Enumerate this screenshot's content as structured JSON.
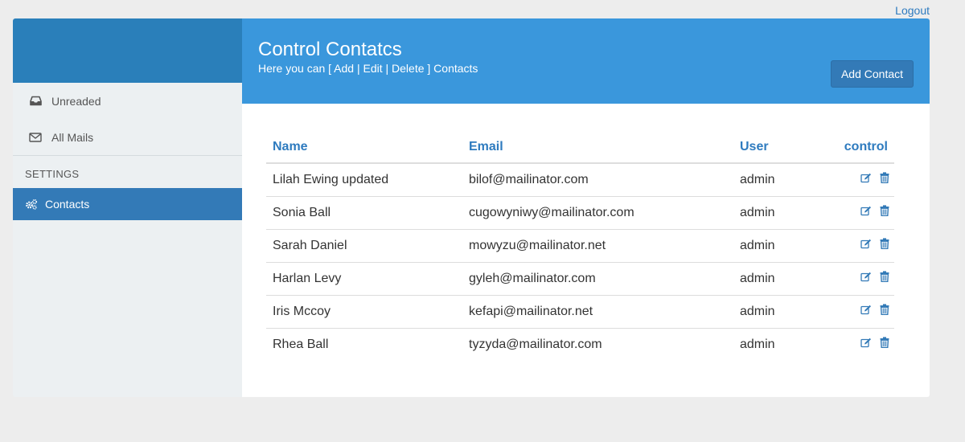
{
  "topbar": {
    "logout_label": "Logout"
  },
  "sidebar": {
    "items": [
      {
        "label": "Unreaded",
        "icon": "inbox-icon"
      },
      {
        "label": "All Mails",
        "icon": "envelope-icon"
      }
    ],
    "section_label": "SETTINGS",
    "active_item": {
      "label": "Contacts",
      "icon": "gears-icon"
    }
  },
  "header": {
    "title": "Control Contatcs",
    "subtitle": "Here you can [ Add | Edit | Delete ] Contacts",
    "add_button_label": "Add Contact"
  },
  "table": {
    "columns": [
      "Name",
      "Email",
      "User",
      "control"
    ],
    "rows": [
      {
        "name": "Lilah Ewing updated",
        "email": "bilof@mailinator.com",
        "user": "admin"
      },
      {
        "name": "Sonia Ball",
        "email": "cugowyniwy@mailinator.com",
        "user": "admin"
      },
      {
        "name": "Sarah Daniel",
        "email": "mowyzu@mailinator.net",
        "user": "admin"
      },
      {
        "name": "Harlan Levy",
        "email": "gyleh@mailinator.com",
        "user": "admin"
      },
      {
        "name": "Iris Mccoy",
        "email": "kefapi@mailinator.net",
        "user": "admin"
      },
      {
        "name": "Rhea Ball",
        "email": "tyzyda@mailinator.com",
        "user": "admin"
      }
    ]
  },
  "colors": {
    "accent": "#337ab7",
    "header_bg": "#3a97dc",
    "sidebar_top": "#2a7fba",
    "link": "#2e7bbf"
  }
}
